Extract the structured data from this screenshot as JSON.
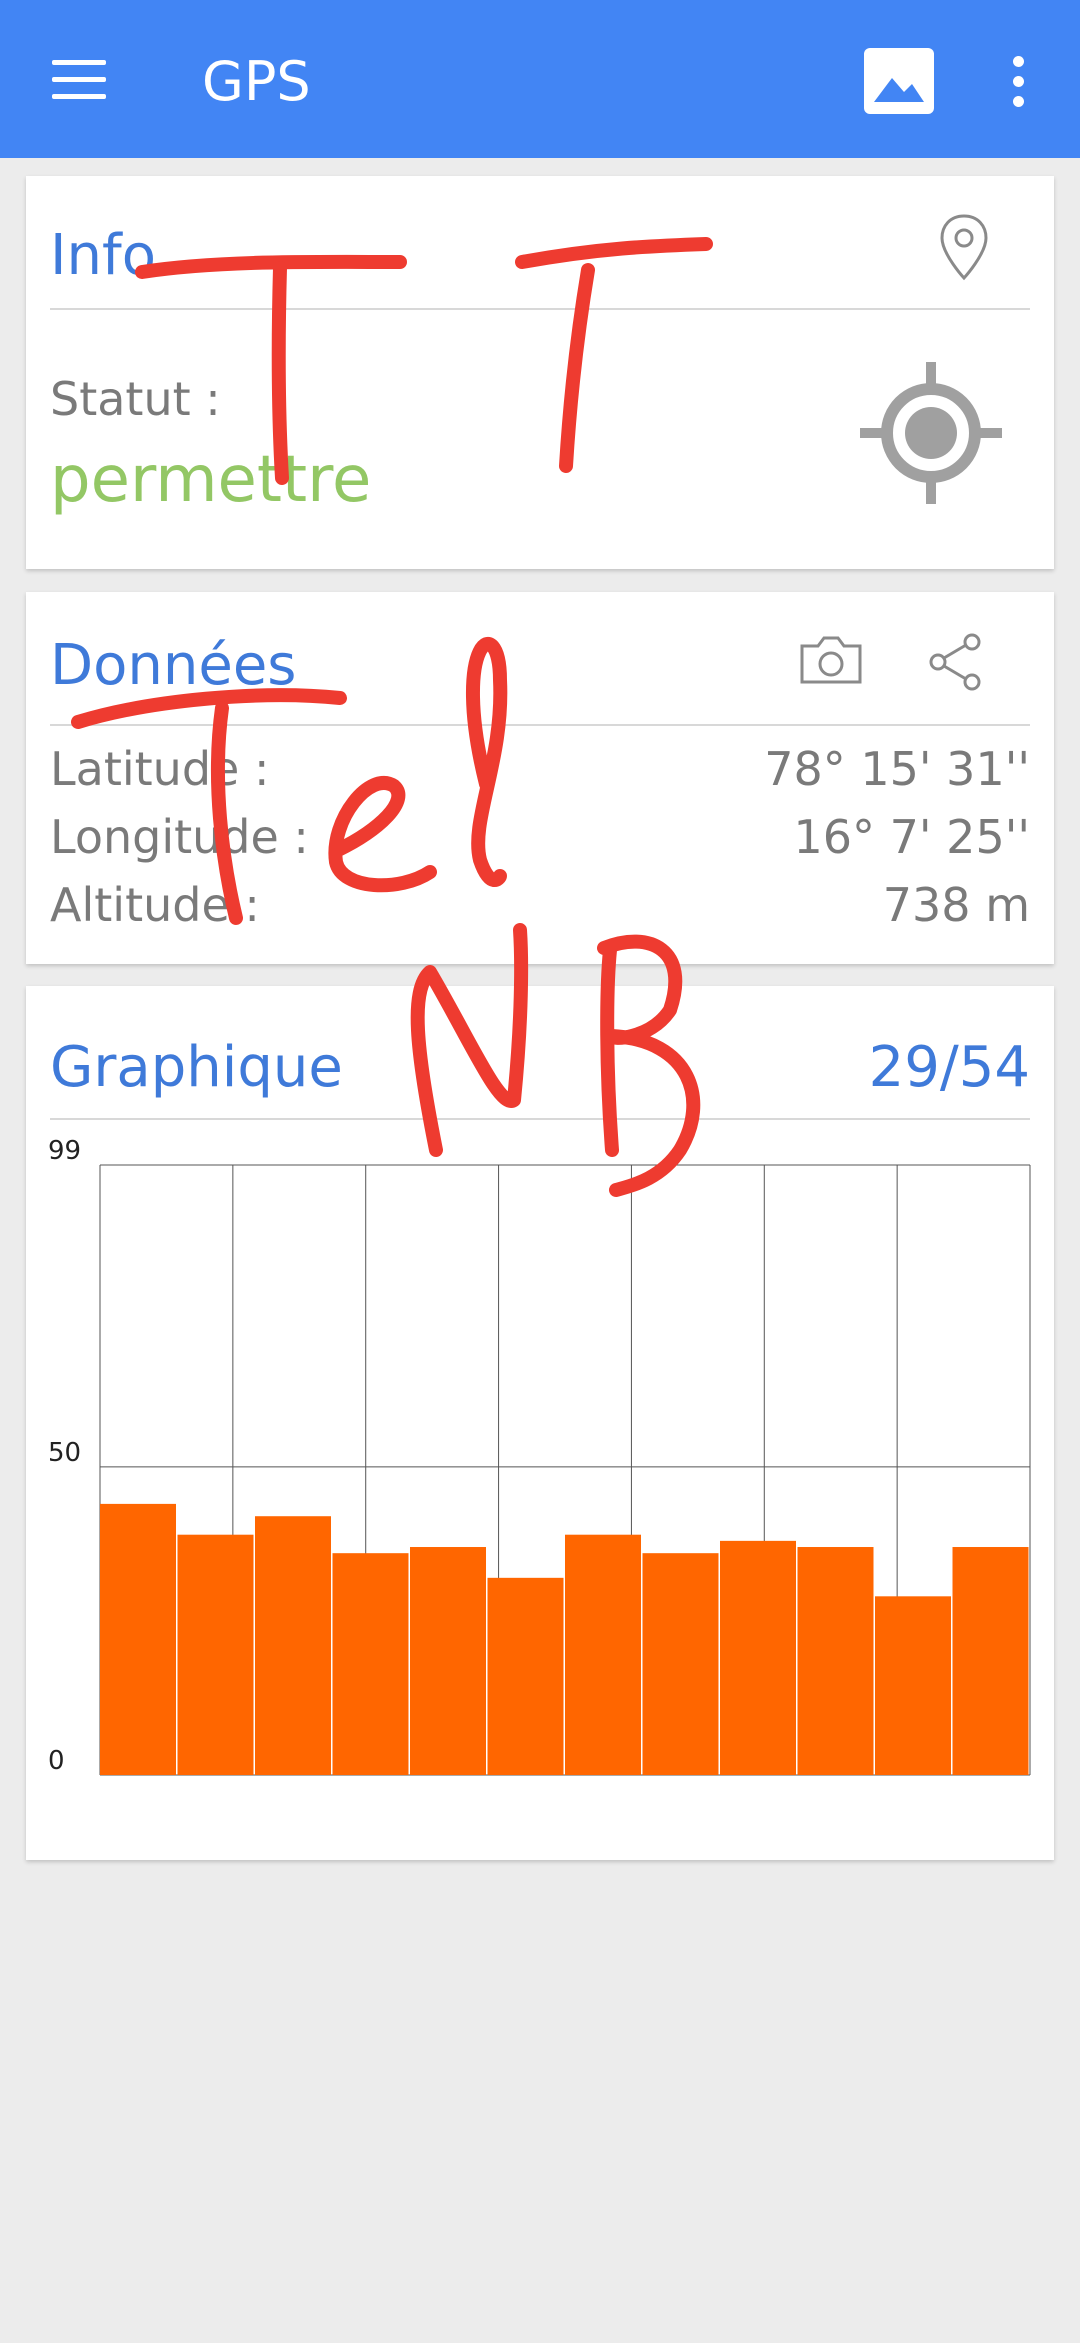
{
  "app_bar": {
    "title": "GPS",
    "background": "#4285f4"
  },
  "info": {
    "title": "Info",
    "status_label": "Statut :",
    "status_value": "permettre"
  },
  "donnees": {
    "title": "Données",
    "rows": [
      {
        "label": "Latitude :",
        "value": "78° 15' 31''"
      },
      {
        "label": "Longitude :",
        "value": "16° 7' 25''"
      },
      {
        "label": "Altitude :",
        "value": "738 m"
      }
    ]
  },
  "graphique": {
    "title": "Graphique",
    "count": "29/54"
  },
  "chart_data": {
    "type": "bar",
    "ylim": [
      0,
      99
    ],
    "y_ticks": [
      "99",
      "50",
      "0"
    ],
    "values": [
      44,
      39,
      42,
      36,
      37,
      32,
      39,
      36,
      38,
      37,
      29,
      37
    ],
    "bar_color": "#ff6600",
    "grid": true
  },
  "annotation_color": "#ee3b30"
}
